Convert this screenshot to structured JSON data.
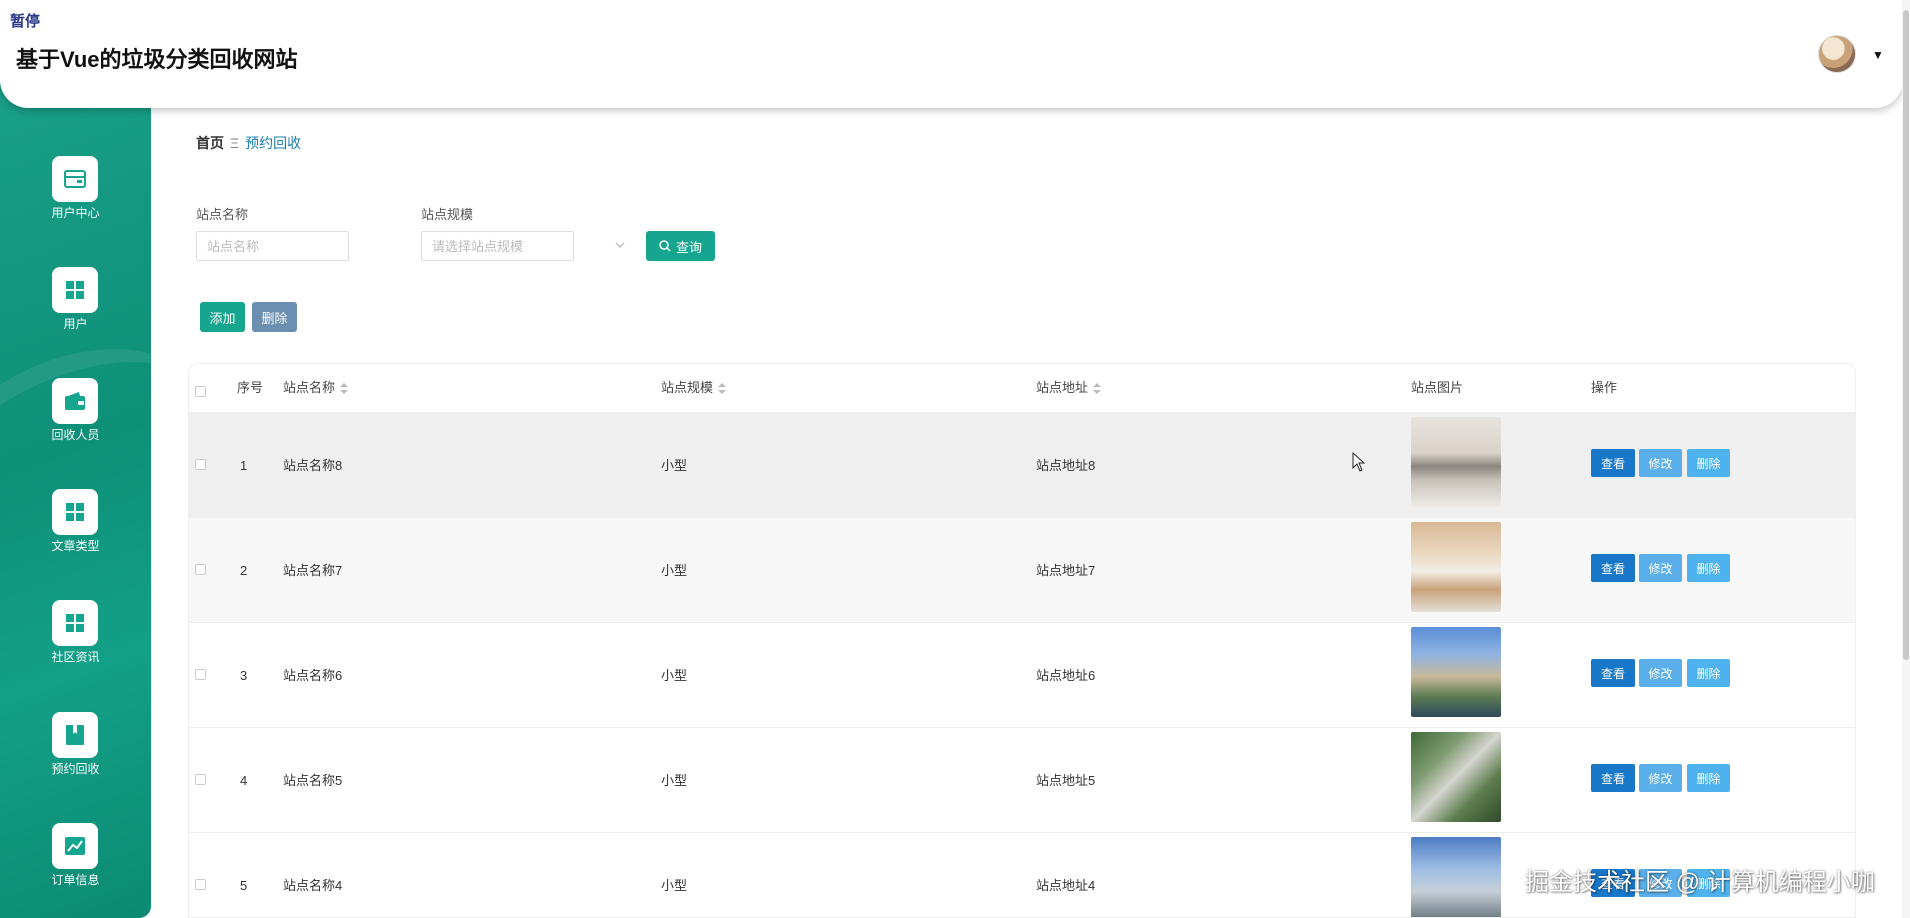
{
  "header": {
    "paused_label": "暂停",
    "site_title": "基于Vue的垃圾分类回收网站",
    "user_menu_icon": "caret-down-icon"
  },
  "sidebar": {
    "items": [
      {
        "label": "用户中心",
        "icon": "card-icon"
      },
      {
        "label": "用户",
        "icon": "grid-icon"
      },
      {
        "label": "回收人员",
        "icon": "wallet-icon"
      },
      {
        "label": "文章类型",
        "icon": "grid-icon"
      },
      {
        "label": "社区资讯",
        "icon": "grid-icon"
      },
      {
        "label": "预约回收",
        "icon": "book-icon"
      },
      {
        "label": "订单信息",
        "icon": "chart-icon"
      }
    ]
  },
  "breadcrumb": {
    "home": "首页",
    "separator": "Ξ",
    "current": "预约回收"
  },
  "filters": {
    "name_label": "站点名称",
    "name_placeholder": "站点名称",
    "scale_label": "站点规模",
    "scale_placeholder": "请选择站点规模",
    "search_label": "查询"
  },
  "actions": {
    "add_label": "添加",
    "delete_label": "删除"
  },
  "table": {
    "headers": {
      "index": "序号",
      "name": "站点名称",
      "scale": "站点规模",
      "address": "站点地址",
      "image": "站点图片",
      "ops": "操作"
    },
    "rows": [
      {
        "index": "1",
        "name": "站点名称8",
        "scale": "小型",
        "address": "站点地址8"
      },
      {
        "index": "2",
        "name": "站点名称7",
        "scale": "小型",
        "address": "站点地址7"
      },
      {
        "index": "3",
        "name": "站点名称6",
        "scale": "小型",
        "address": "站点地址6"
      },
      {
        "index": "4",
        "name": "站点名称5",
        "scale": "小型",
        "address": "站点地址5"
      },
      {
        "index": "5",
        "name": "站点名称4",
        "scale": "小型",
        "address": "站点地址4"
      }
    ],
    "row_actions": {
      "view": "查看",
      "edit": "修改",
      "delete": "删除"
    }
  },
  "watermark": "掘金技术社区 @ 计算机编程小咖",
  "colors": {
    "primary": "#16a58e",
    "sidebar": "#0e8f78",
    "view_button": "#1877c9",
    "edit_button": "#5aaeea",
    "link": "#1a7fb0"
  }
}
